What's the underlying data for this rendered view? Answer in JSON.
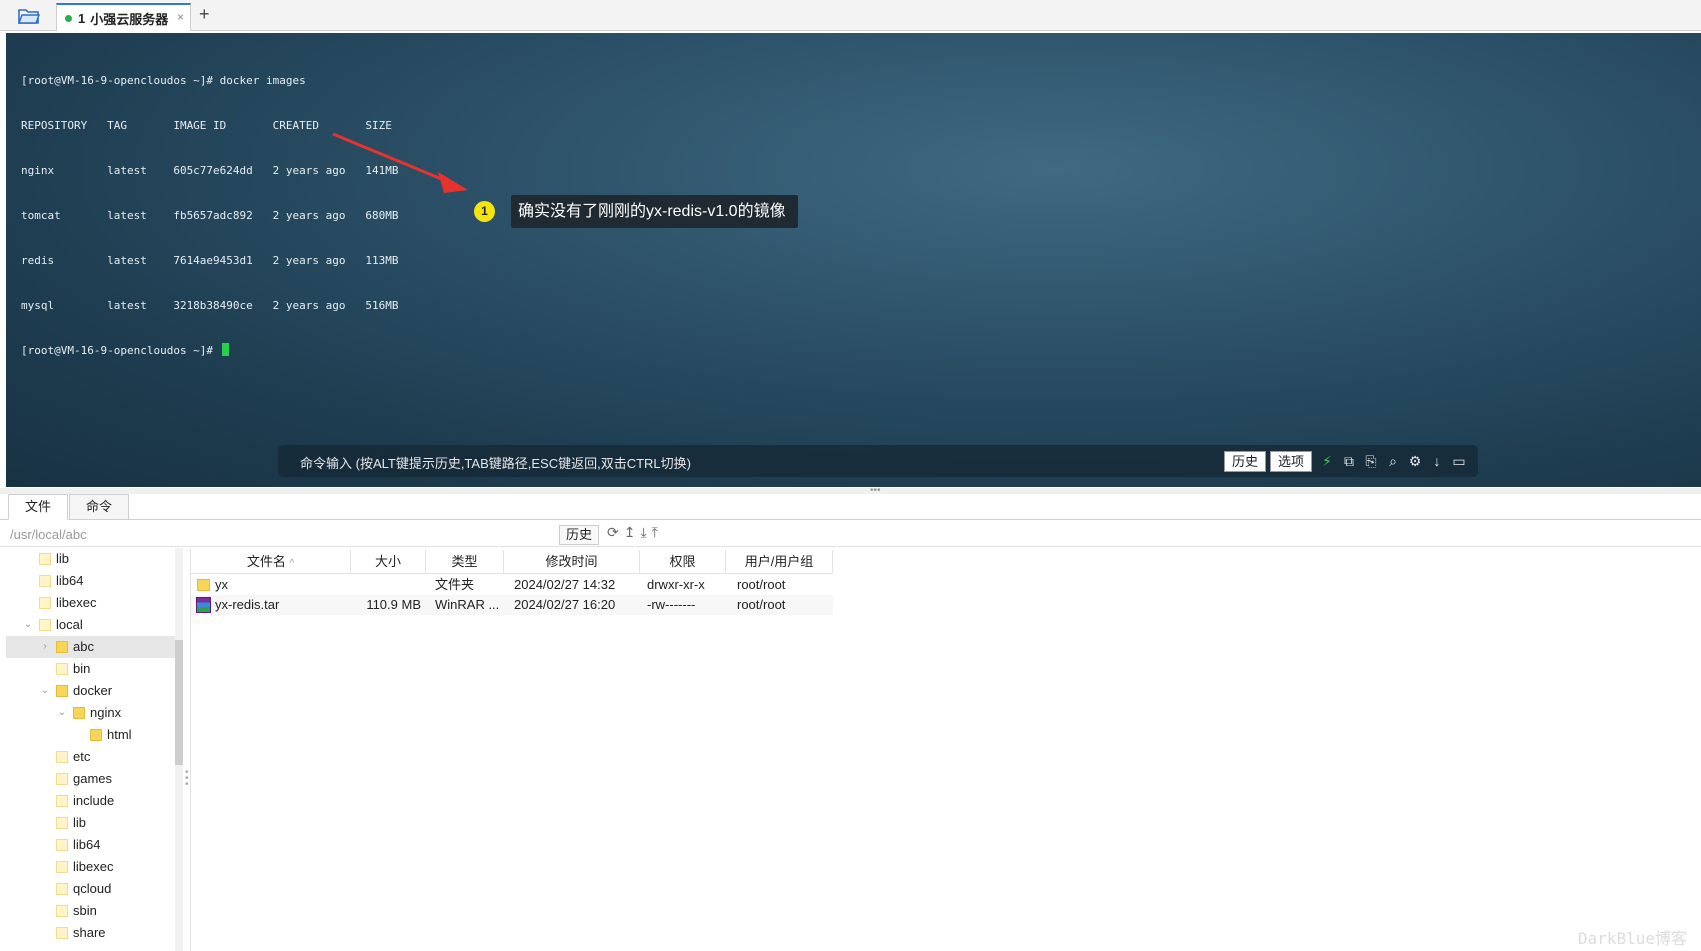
{
  "session_tab": {
    "number": "1",
    "title": "小强云服务器",
    "close": "×",
    "new_tab": "+"
  },
  "terminal": {
    "lines": [
      "[root@VM-16-9-opencloudos ~]# docker images",
      "REPOSITORY   TAG       IMAGE ID       CREATED       SIZE",
      "nginx        latest    605c77e624dd   2 years ago   141MB",
      "tomcat       latest    fb5657adc892   2 years ago   680MB",
      "redis        latest    7614ae9453d1   2 years ago   113MB",
      "mysql        latest    3218b38490ce   2 years ago   516MB",
      "[root@VM-16-9-opencloudos ~]# "
    ],
    "annotation_badge": "1",
    "annotation_text": "确实没有了刚刚的yx-redis-v1.0的镜像",
    "cmd_hint": "命令输入 (按ALT键提示历史,TAB键路径,ESC键返回,双击CTRL切换)",
    "history_label": "历史",
    "options_label": "选项"
  },
  "lower_tabs": [
    "文件",
    "命令"
  ],
  "path": {
    "value": "/usr/local/abc",
    "history_label": "历史"
  },
  "tree": [
    {
      "label": "lib",
      "depth": 1,
      "toggle": "",
      "closed": false,
      "selected": false
    },
    {
      "label": "lib64",
      "depth": 1,
      "toggle": "",
      "closed": false,
      "selected": false
    },
    {
      "label": "libexec",
      "depth": 1,
      "toggle": "",
      "closed": false,
      "selected": false
    },
    {
      "label": "local",
      "depth": 1,
      "toggle": "⌄",
      "closed": false,
      "selected": false
    },
    {
      "label": "abc",
      "depth": 2,
      "toggle": "›",
      "closed": true,
      "selected": true
    },
    {
      "label": "bin",
      "depth": 2,
      "toggle": "",
      "closed": false,
      "selected": false
    },
    {
      "label": "docker",
      "depth": 2,
      "toggle": "⌄",
      "closed": true,
      "selected": false
    },
    {
      "label": "nginx",
      "depth": 3,
      "toggle": "⌄",
      "closed": true,
      "selected": false
    },
    {
      "label": "html",
      "depth": 4,
      "toggle": "",
      "closed": true,
      "selected": false
    },
    {
      "label": "etc",
      "depth": 2,
      "toggle": "",
      "closed": false,
      "selected": false
    },
    {
      "label": "games",
      "depth": 2,
      "toggle": "",
      "closed": false,
      "selected": false
    },
    {
      "label": "include",
      "depth": 2,
      "toggle": "",
      "closed": false,
      "selected": false
    },
    {
      "label": "lib",
      "depth": 2,
      "toggle": "",
      "closed": false,
      "selected": false
    },
    {
      "label": "lib64",
      "depth": 2,
      "toggle": "",
      "closed": false,
      "selected": false
    },
    {
      "label": "libexec",
      "depth": 2,
      "toggle": "",
      "closed": false,
      "selected": false
    },
    {
      "label": "qcloud",
      "depth": 2,
      "toggle": "",
      "closed": false,
      "selected": false
    },
    {
      "label": "sbin",
      "depth": 2,
      "toggle": "",
      "closed": false,
      "selected": false
    },
    {
      "label": "share",
      "depth": 2,
      "toggle": "",
      "closed": false,
      "selected": false
    }
  ],
  "file_columns": [
    "文件名",
    "大小",
    "类型",
    "修改时间",
    "权限",
    "用户/用户组"
  ],
  "sort_indicator": "^",
  "files": [
    {
      "name": "yx",
      "icon": "folder-icon",
      "size": "",
      "type": "文件夹",
      "mtime": "2024/02/27 14:32",
      "perm": "drwxr-xr-x",
      "owner": "root/root"
    },
    {
      "name": "yx-redis.tar",
      "icon": "winrar-archive-icon",
      "size": "110.9 MB",
      "type": "WinRAR ...",
      "mtime": "2024/02/27 16:20",
      "perm": "-rw-------",
      "owner": "root/root"
    }
  ],
  "watermark": "DarkBlue博客"
}
